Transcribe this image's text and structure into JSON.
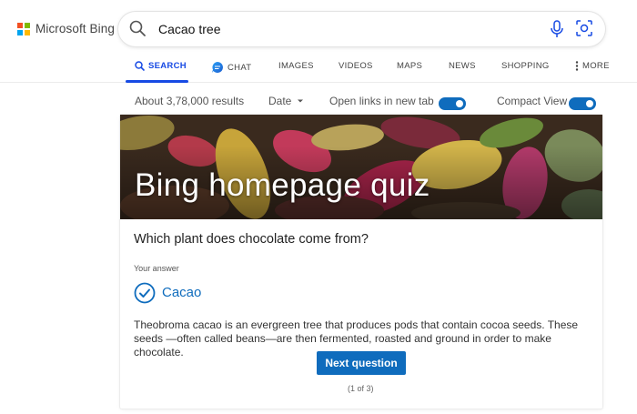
{
  "brand": {
    "name": "Microsoft Bing",
    "colors": [
      "#f25022",
      "#7fba00",
      "#00a4ef",
      "#ffb900"
    ]
  },
  "search": {
    "query": "Cacao tree",
    "icon": "search-icon",
    "mic_icon": "microphone-icon",
    "visual_icon": "visual-search-icon"
  },
  "tabs": [
    {
      "label": "SEARCH",
      "active": true,
      "icon": "search-icon"
    },
    {
      "label": "CHAT",
      "icon": "copilot-chat-icon"
    },
    {
      "label": "IMAGES"
    },
    {
      "label": "VIDEOS"
    },
    {
      "label": "MAPS"
    },
    {
      "label": "NEWS"
    },
    {
      "label": "SHOPPING"
    },
    {
      "label": "MORE",
      "icon": "more-vertical-icon"
    }
  ],
  "results_bar": {
    "count": "About 3,78,000 results",
    "date_filter": "Date",
    "open_links_label": "Open links in new tab",
    "open_links_on": true,
    "compact_view_label": "Compact View",
    "compact_view_on": true
  },
  "quiz": {
    "title": "Bing homepage quiz",
    "question": "Which plant does chocolate come from?",
    "your_answer_label": "Your answer",
    "answer": "Cacao",
    "explanation": "Theobroma cacao is an evergreen tree that produces pods that contain cocoa seeds. These seeds —often called beans—are then fermented, roasted and ground in order to make chocolate.",
    "next_button": "Next question",
    "counter": "(1 of 3)"
  },
  "accent_color": "#0f6cbd"
}
